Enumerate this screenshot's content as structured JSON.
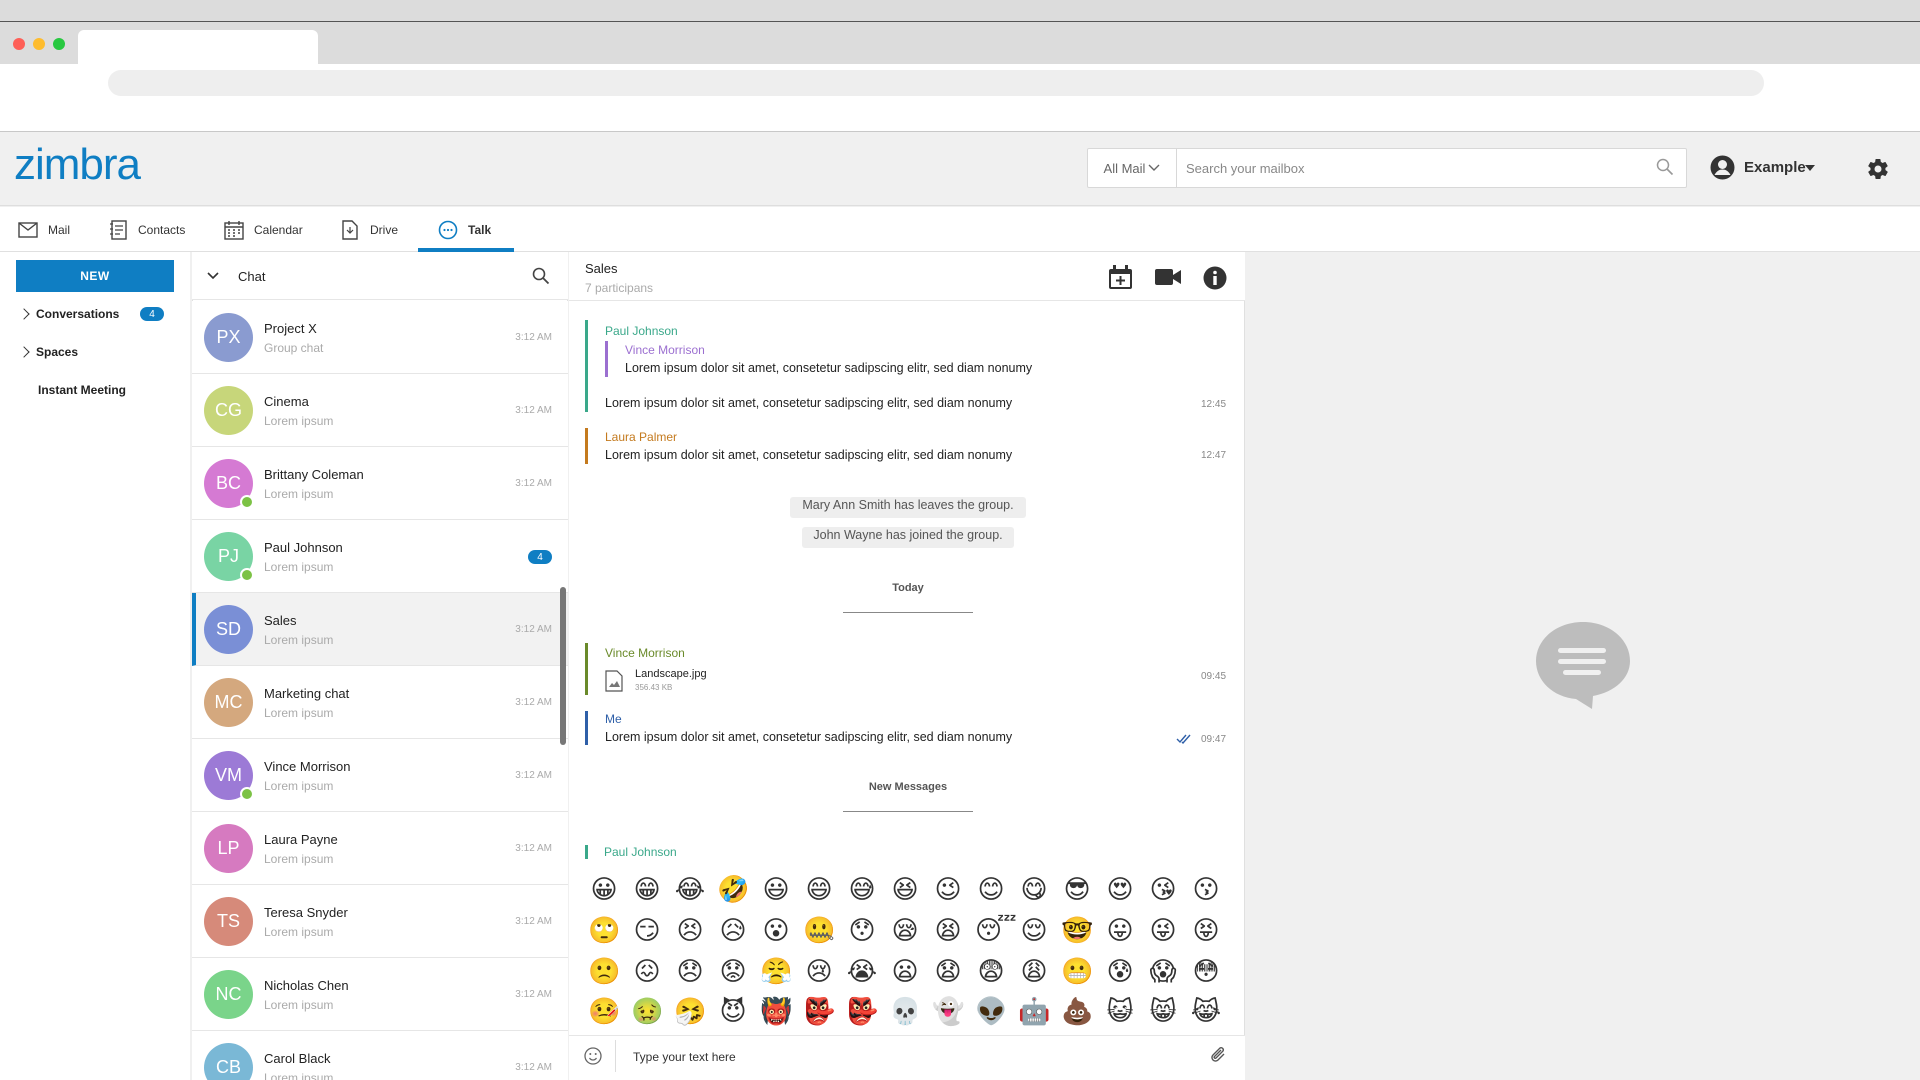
{
  "header": {
    "logo": "zimbra",
    "search_scope": "All Mail",
    "search_placeholder": "Search your mailbox",
    "user_name": "Example"
  },
  "app_tabs": [
    {
      "label": "Mail",
      "icon": "mail-icon"
    },
    {
      "label": "Contacts",
      "icon": "contacts-icon"
    },
    {
      "label": "Calendar",
      "icon": "calendar-icon"
    },
    {
      "label": "Drive",
      "icon": "drive-icon"
    },
    {
      "label": "Talk",
      "icon": "talk-icon",
      "active": true
    }
  ],
  "sidebar": {
    "new_label": "NEW",
    "items": [
      {
        "label": "Conversations",
        "badge": "4"
      },
      {
        "label": "Spaces"
      },
      {
        "label": "Instant Meeting"
      }
    ]
  },
  "chat_list": {
    "title": "Chat",
    "rows": [
      {
        "initials": "PX",
        "name": "Project X",
        "sub": "Group chat",
        "time": "3:12 AM",
        "color": "#8a9bd0"
      },
      {
        "initials": "CG",
        "name": "Cinema",
        "sub": "Lorem ipsum",
        "time": "3:12 AM",
        "color": "#c7d67a"
      },
      {
        "initials": "BC",
        "name": "Brittany Coleman",
        "sub": "Lorem ipsum",
        "time": "3:12 AM",
        "color": "#d57ad3",
        "online": true
      },
      {
        "initials": "PJ",
        "name": "Paul Johnson",
        "sub": "Lorem ipsum",
        "badge": "4",
        "color": "#79d4a4",
        "online": true
      },
      {
        "initials": "SD",
        "name": "Sales",
        "sub": "Lorem ipsum",
        "time": "3:12 AM",
        "color": "#7a8fd6",
        "active": true
      },
      {
        "initials": "MC",
        "name": "Marketing chat",
        "sub": "Lorem ipsum",
        "time": "3:12 AM",
        "color": "#d4a87e"
      },
      {
        "initials": "VM",
        "name": "Vince Morrison",
        "sub": "Lorem ipsum",
        "time": "3:12 AM",
        "color": "#9c7ad6",
        "online": true
      },
      {
        "initials": "LP",
        "name": "Laura Payne",
        "sub": "Lorem ipsum",
        "time": "3:12 AM",
        "color": "#d67ac0"
      },
      {
        "initials": "TS",
        "name": "Teresa Snyder",
        "sub": "Lorem ipsum",
        "time": "3:12 AM",
        "color": "#d68a7a"
      },
      {
        "initials": "NC",
        "name": "Nicholas Chen",
        "sub": "Lorem ipsum",
        "time": "3:12 AM",
        "color": "#7ad48a"
      },
      {
        "initials": "CB",
        "name": "Carol Black",
        "sub": "Lorem ipsum",
        "time": "3:12 AM",
        "color": "#7ab8d6"
      }
    ]
  },
  "conversation": {
    "title": "Sales",
    "subtitle": "7 participans",
    "messages": {
      "m1_sender": "Paul Johnson",
      "m1_quote_sender": "Vince Morrison",
      "m1_quote_text": "Lorem ipsum dolor sit amet, consetetur sadipscing elitr, sed diam nonumy",
      "m1_text": "Lorem ipsum dolor sit amet, consetetur sadipscing elitr, sed diam nonumy",
      "m1_time": "12:45",
      "m2_sender": "Laura Palmer",
      "m2_text": "Lorem ipsum dolor sit amet, consetetur sadipscing elitr, sed diam nonumy",
      "m2_time": "12:47",
      "sys1": "Mary Ann Smith has leaves the group.",
      "sys2": "John Wayne has joined the group.",
      "today": "Today",
      "m3_sender": "Vince Morrison",
      "m3_file": "Landscape.jpg",
      "m3_size": "356.43 KB",
      "m3_time": "09:45",
      "m4_sender": "Me",
      "m4_text": "Lorem ipsum dolor sit amet, consetetur sadipscing elitr, sed diam nonumy",
      "m4_time": "09:47",
      "new_messages": "New Messages",
      "m5_sender": "Paul Johnson"
    },
    "emojis": [
      "😀",
      "😁",
      "😂",
      "🤣",
      "😃",
      "😄",
      "😅",
      "😆",
      "😉",
      "😊",
      "😋",
      "😎",
      "😍",
      "😘",
      "😗",
      "🙄",
      "😏",
      "😣",
      "😥",
      "😮",
      "🤐",
      "😯",
      "😪",
      "😫",
      "😴",
      "😌",
      "🤓",
      "😛",
      "😜",
      "😝",
      "🙁",
      "😖",
      "😞",
      "😟",
      "😤",
      "😢",
      "😭",
      "😦",
      "😧",
      "😨",
      "😩",
      "😬",
      "😰",
      "😱",
      "😳",
      "🤒",
      "🤢",
      "🤧",
      "😈",
      "👹",
      "👺",
      "👺",
      "💀",
      "👻",
      "👽",
      "🤖",
      "💩",
      "😺",
      "😸",
      "😹"
    ],
    "composer_placeholder": "Type your text here"
  },
  "colors": {
    "accent": "#0f7ec3",
    "paul": "#3aa88a",
    "vince_quote": "#9b6fd0",
    "laura": "#c47a1e",
    "vince": "#6a8a2a",
    "me": "#2e5fa8"
  }
}
